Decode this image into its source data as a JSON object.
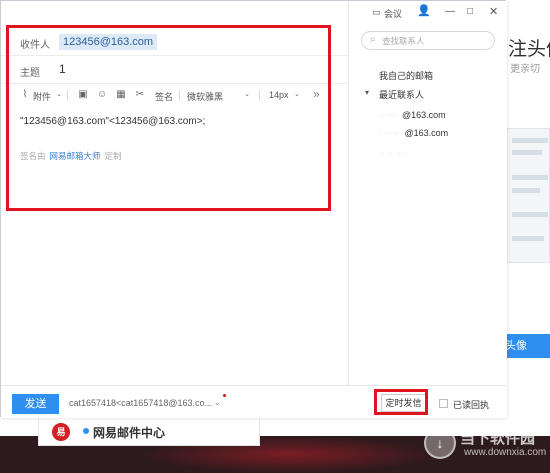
{
  "background": {
    "heading": "注头像",
    "subtext": "更亲切",
    "blue_button": "头像",
    "mail_center": "网易邮件中心",
    "watermark_title": "当下软件园",
    "watermark_sub": "www.downxia.com"
  },
  "compose": {
    "to_label": "收件人",
    "to_value": "123456@163.com",
    "subject_label": "主题",
    "subject_value": "1",
    "toolbar": {
      "attach": "附件",
      "signature": "签名",
      "font": "微软雅黑",
      "size": "14px",
      "more": "»"
    },
    "body": "\"123456@163.com\"<123456@163.com>;",
    "sig_prefix": "签名由",
    "sig_link": "网易邮箱大师",
    "sig_custom": "定制"
  },
  "titlebar": {
    "meeting": "会议"
  },
  "contacts": {
    "search_placeholder": "查找联系人",
    "my_mailbox": "我自己的邮箱",
    "recent": "最近联系人",
    "items": [
      "@163.com",
      "@163.com",
      ""
    ]
  },
  "bottom": {
    "send": "发送",
    "sender": "cat1657418<cat1657418@163.co...",
    "scheduled": "定时发信",
    "read_receipt": "已读回执"
  },
  "colors": {
    "accent": "#2e8ff0",
    "highlight": "#e0141e"
  }
}
